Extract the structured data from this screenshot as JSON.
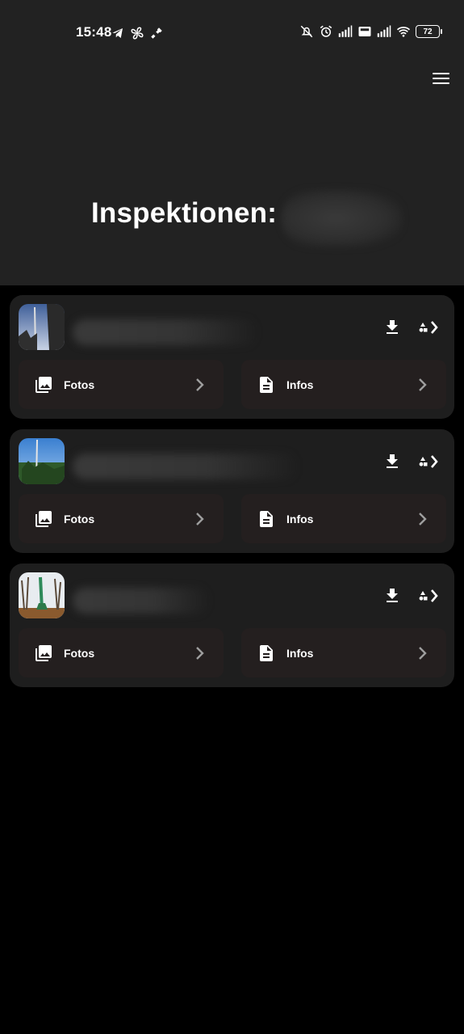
{
  "status_bar": {
    "time": "15:48",
    "battery": "72",
    "left_icons": [
      "telegram-icon",
      "fan-icon",
      "satellite-icon"
    ],
    "right_icons": [
      "mute-icon",
      "alarm-icon",
      "signal-icon",
      "volte-icon",
      "signal-icon",
      "wifi-icon",
      "battery-icon"
    ]
  },
  "header": {
    "title": "Inspektionen:",
    "menu_icon": "hamburger-menu-icon"
  },
  "inspections": [
    {
      "photo_icon": "image-gallery-icon",
      "fotos_label": "Fotos",
      "infos_label": "Infos"
    },
    {
      "photo_icon": "image-gallery-icon",
      "fotos_label": "Fotos",
      "infos_label": "Infos"
    },
    {
      "photo_icon": "image-gallery-icon",
      "fotos_label": "Fotos",
      "infos_label": "Infos"
    }
  ],
  "colors": {
    "header_bg": "#222222",
    "page_bg": "#000000",
    "card_bg": "#1e1e1e",
    "action_bg": "#241f1f",
    "text": "#ffffff",
    "chevron": "#9e9e9e"
  }
}
